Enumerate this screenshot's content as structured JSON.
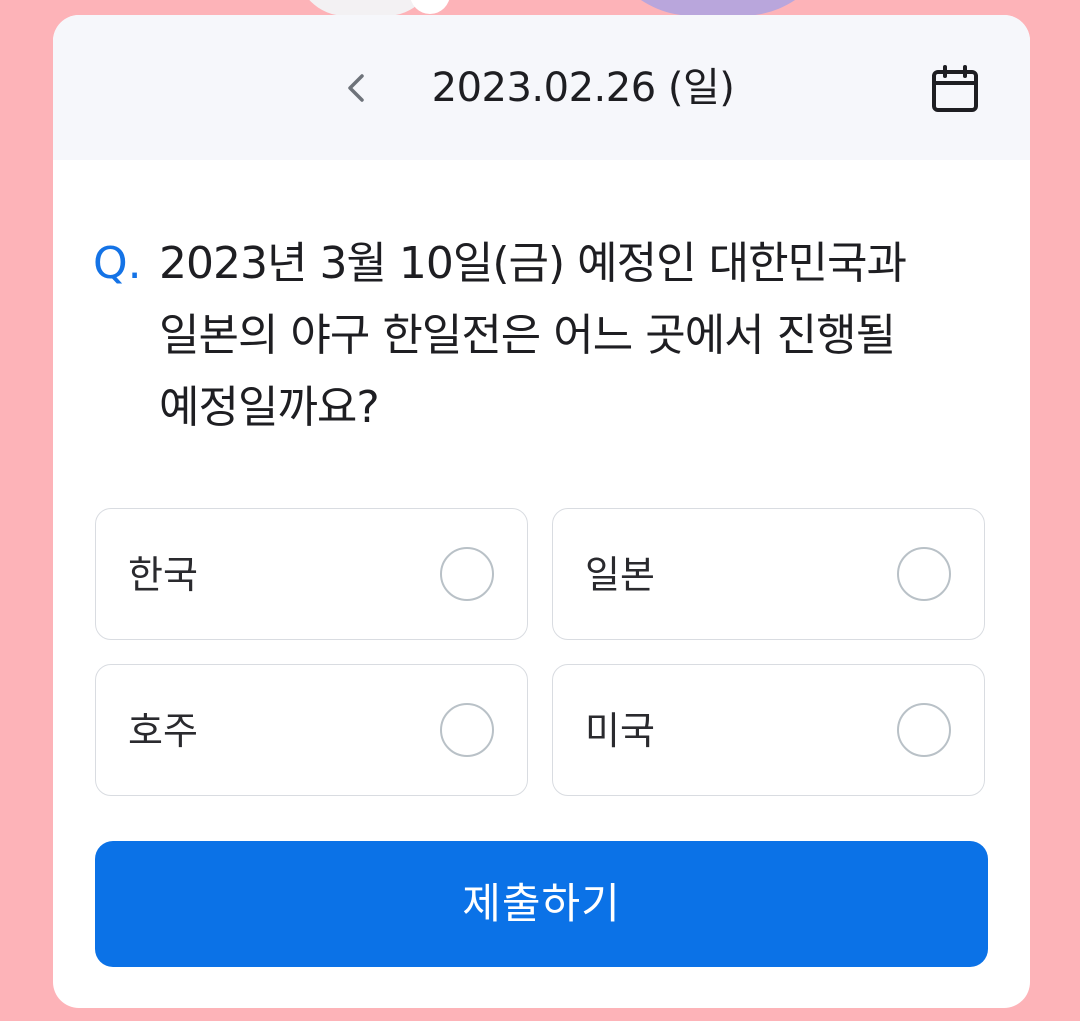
{
  "header": {
    "date": "2023.02.26 (일)",
    "back_icon": "chevron-left-icon",
    "calendar_icon": "calendar-icon"
  },
  "quiz": {
    "prefix": "Q.",
    "question": "2023년 3월 10일(금) 예정인 대한민국과 일본의 야구 한일전은 어느 곳에서 진행될 예정일까요?",
    "options": [
      {
        "label": "한국",
        "selected": false
      },
      {
        "label": "일본",
        "selected": false
      },
      {
        "label": "호주",
        "selected": false
      },
      {
        "label": "미국",
        "selected": false
      }
    ]
  },
  "submit_label": "제출하기",
  "colors": {
    "background": "#fdb3b8",
    "accent": "#0b72e7",
    "question_prefix": "#1473e6",
    "header_bg": "#f6f7fb"
  }
}
